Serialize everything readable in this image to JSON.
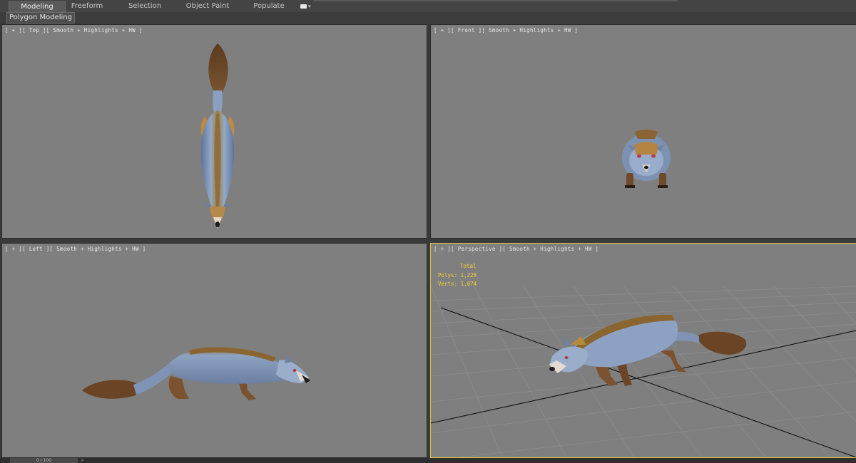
{
  "ribbon": {
    "tabs": [
      {
        "label": "Modeling",
        "active": true
      },
      {
        "label": "Freeform"
      },
      {
        "label": "Selection"
      },
      {
        "label": "Object Paint"
      },
      {
        "label": "Populate"
      }
    ],
    "extra_icon": "camera-icon"
  },
  "subbar": {
    "panel_label": "Polygon Modeling"
  },
  "viewports": {
    "top": {
      "label": "[ + ][ Top ][ Smooth + Highlights + HW ]"
    },
    "front": {
      "label": "[ + ][ Front ][ Smooth + Highlights + HW ]"
    },
    "left": {
      "label": "[ + ][ Left ][ Smooth + Highlights + HW ]"
    },
    "perspective": {
      "label": "[ + ][ Perspective ][ Smooth + Highlights + HW ]",
      "stats": {
        "total_label": "Total",
        "polys": "Polys: 1,228",
        "verts": "Verts: 1,074"
      }
    }
  },
  "timeline": {
    "frame": "0 / 100"
  },
  "colors": {
    "viewport_bg": "#7f7f7f",
    "active_border": "#d9c34c",
    "stats_text": "#f2d230",
    "fur_blue": "#7f93b3",
    "fur_brown": "#6e4a2a"
  }
}
